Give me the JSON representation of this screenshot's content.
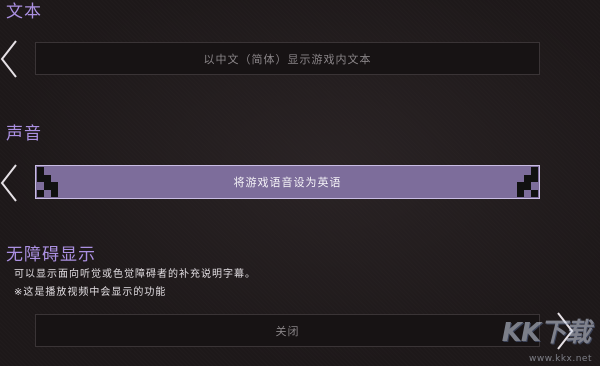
{
  "sections": {
    "text": {
      "title": "文本",
      "option_value": "以中文（简体）显示游戏内文本"
    },
    "audio": {
      "title": "声音",
      "option_value": "将游戏语音设为英语"
    },
    "accessibility": {
      "title": "无障碍显示",
      "description_line1": "可以显示面向听觉或色觉障碍者的补充说明字幕。",
      "description_line2": "※这是播放视频中会显示的功能",
      "option_value": "关闭"
    }
  },
  "watermark": {
    "logo_text": "KK下载",
    "url_text": "www.kkx.net"
  },
  "colors": {
    "background": "#1d1819",
    "section_title": "#ab90e2",
    "selected_option_bg": "#7d6d9b",
    "unselected_option_bg": "#171314"
  }
}
